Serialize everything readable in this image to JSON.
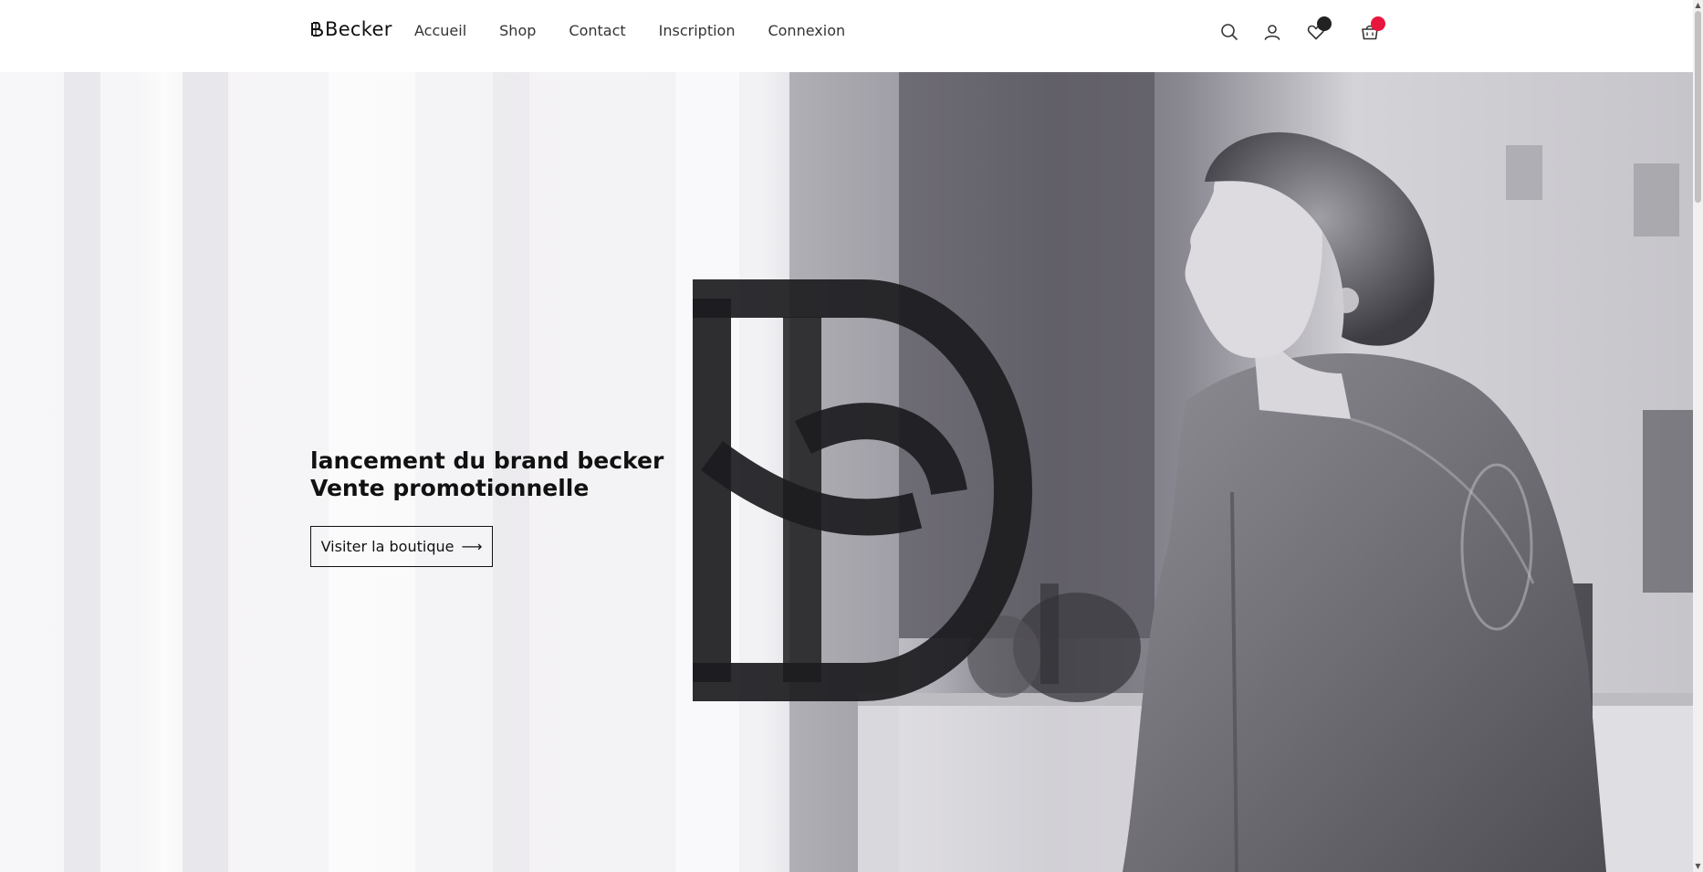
{
  "header": {
    "logo_text": "Becker",
    "logo_mark_icon": "becker-monogram-icon",
    "nav": [
      {
        "label": "Accueil"
      },
      {
        "label": "Shop"
      },
      {
        "label": "Contact"
      },
      {
        "label": "Inscription"
      },
      {
        "label": "Connexion"
      }
    ],
    "icons": {
      "search": "search-icon",
      "account": "user-icon",
      "wishlist": "heart-icon",
      "cart": "shopping-basket-icon"
    },
    "wishlist_badge_color": "#222222",
    "cart_badge_color": "#e8163f"
  },
  "hero": {
    "title_line_1": "lancement du brand becker",
    "title_line_2": "Vente promotionnelle",
    "cta_label": "Visiter la boutique",
    "cta_icon": "arrow-right-icon",
    "background_image": "woman-in-denim-jacket-black-and-white-photo",
    "overlay_logo": "becker-monogram-logo"
  },
  "colors": {
    "text": "#111111",
    "header_bg": "#ffffff",
    "accent": "#e8163f"
  }
}
